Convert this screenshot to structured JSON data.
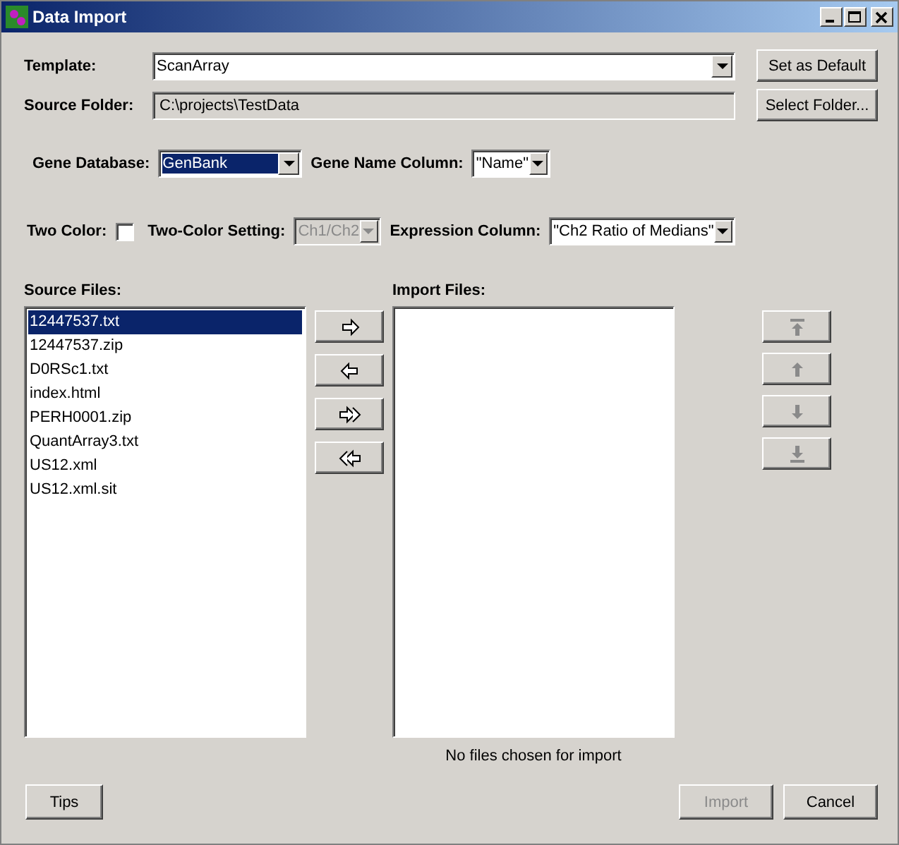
{
  "window": {
    "title": "Data Import",
    "controls": [
      {
        "kind": "minimize"
      },
      {
        "kind": "maximize"
      },
      {
        "kind": "close"
      }
    ]
  },
  "template": {
    "label": "Template:",
    "value": "ScanArray",
    "button": "Set as Default"
  },
  "source_folder": {
    "label": "Source Folder:",
    "value": "C:\\projects\\TestData",
    "button": "Select Folder..."
  },
  "gene_database": {
    "label": "Gene Database:",
    "value": "GenBank",
    "focused": true
  },
  "gene_name_column": {
    "label": "Gene Name Column:",
    "value": "\"Name\"",
    "disabled": false
  },
  "two_color": {
    "label": "Two Color:",
    "checked": false
  },
  "two_color_setting": {
    "label": "Two-Color Setting:",
    "value": "Ch1/Ch2",
    "disabled": true
  },
  "expression_column": {
    "label": "Expression Column:",
    "value": "\"Ch2 Ratio of Medians\"",
    "disabled": false
  },
  "source_files": {
    "label": "Source Files:",
    "items": [
      {
        "name": "12447537.txt",
        "selected": true
      },
      {
        "name": "12447537.zip",
        "selected": false
      },
      {
        "name": "D0RSc1.txt",
        "selected": false
      },
      {
        "name": "index.html",
        "selected": false
      },
      {
        "name": "PERH0001.zip",
        "selected": false
      },
      {
        "name": "QuantArray3.txt",
        "selected": false
      },
      {
        "name": "US12.xml",
        "selected": false
      },
      {
        "name": "US12.xml.sit",
        "selected": false
      }
    ]
  },
  "transfer_buttons": [
    {
      "kind": "add"
    },
    {
      "kind": "remove"
    },
    {
      "kind": "add_all"
    },
    {
      "kind": "remove_all"
    }
  ],
  "import_files": {
    "label": "Import Files:",
    "status": "No files chosen for import"
  },
  "order_buttons": [
    {
      "kind": "top",
      "disabled": true
    },
    {
      "kind": "up",
      "disabled": true
    },
    {
      "kind": "down",
      "disabled": true
    },
    {
      "kind": "bottom",
      "disabled": true
    }
  ],
  "buttons": [
    {
      "label": "Tips",
      "disabled": false
    },
    {
      "label": "Import",
      "disabled": true
    },
    {
      "label": "Cancel",
      "disabled": false
    }
  ]
}
